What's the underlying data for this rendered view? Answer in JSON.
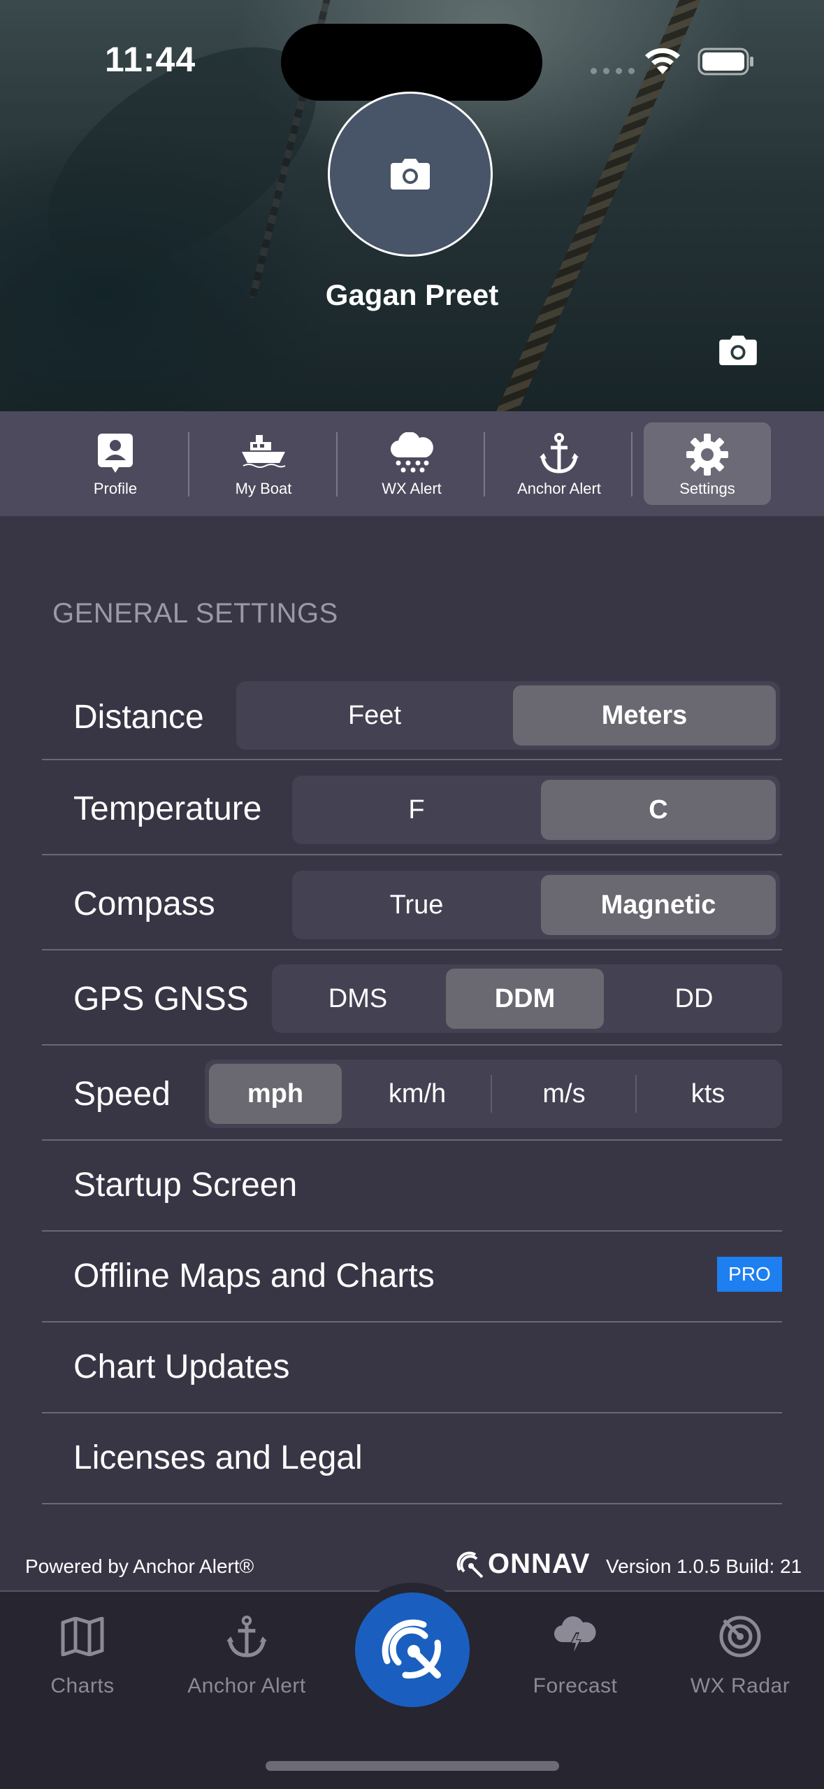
{
  "status": {
    "time": "11:44"
  },
  "profile": {
    "name": "Gagan Preet"
  },
  "tabs": [
    {
      "label": "Profile",
      "icon": "profile-icon"
    },
    {
      "label": "My Boat",
      "icon": "boat-icon"
    },
    {
      "label": "WX Alert",
      "icon": "weather-alert-icon"
    },
    {
      "label": "Anchor Alert",
      "icon": "anchor-icon"
    },
    {
      "label": "Settings",
      "icon": "gear-icon",
      "active": true
    }
  ],
  "settings": {
    "section_title": "GENERAL SETTINGS",
    "distance": {
      "label": "Distance",
      "options": [
        "Feet",
        "Meters"
      ],
      "selected": "Meters"
    },
    "temperature": {
      "label": "Temperature",
      "options": [
        "F",
        "C"
      ],
      "selected": "C"
    },
    "compass": {
      "label": "Compass",
      "options": [
        "True",
        "Magnetic"
      ],
      "selected": "Magnetic"
    },
    "gps": {
      "label": "GPS GNSS",
      "options": [
        "DMS",
        "DDM",
        "DD"
      ],
      "selected": "DDM"
    },
    "speed": {
      "label": "Speed",
      "options": [
        "mph",
        "km/h",
        "m/s",
        "kts"
      ],
      "selected": "mph"
    },
    "links": [
      {
        "label": "Startup Screen"
      },
      {
        "label": "Offline Maps and Charts",
        "badge": "PRO"
      },
      {
        "label": "Chart Updates"
      },
      {
        "label": "Licenses and Legal"
      }
    ]
  },
  "footer": {
    "powered_by": "Powered by Anchor Alert®",
    "brand": "ONNAV",
    "version": "Version 1.0.5 Build: 21"
  },
  "bottom_nav": [
    {
      "label": "Charts",
      "icon": "map-icon"
    },
    {
      "label": "Anchor Alert",
      "icon": "anchor-icon"
    },
    {
      "label": "Forecast",
      "icon": "storm-cloud-icon"
    },
    {
      "label": "WX Radar",
      "icon": "radar-icon"
    }
  ],
  "colors": {
    "background": "#383645",
    "tab_bar": "#4c4a5c",
    "selected_segment": "#6a6870",
    "pro_badge": "#1e7ff0",
    "center_button": "#1a5fbf"
  }
}
